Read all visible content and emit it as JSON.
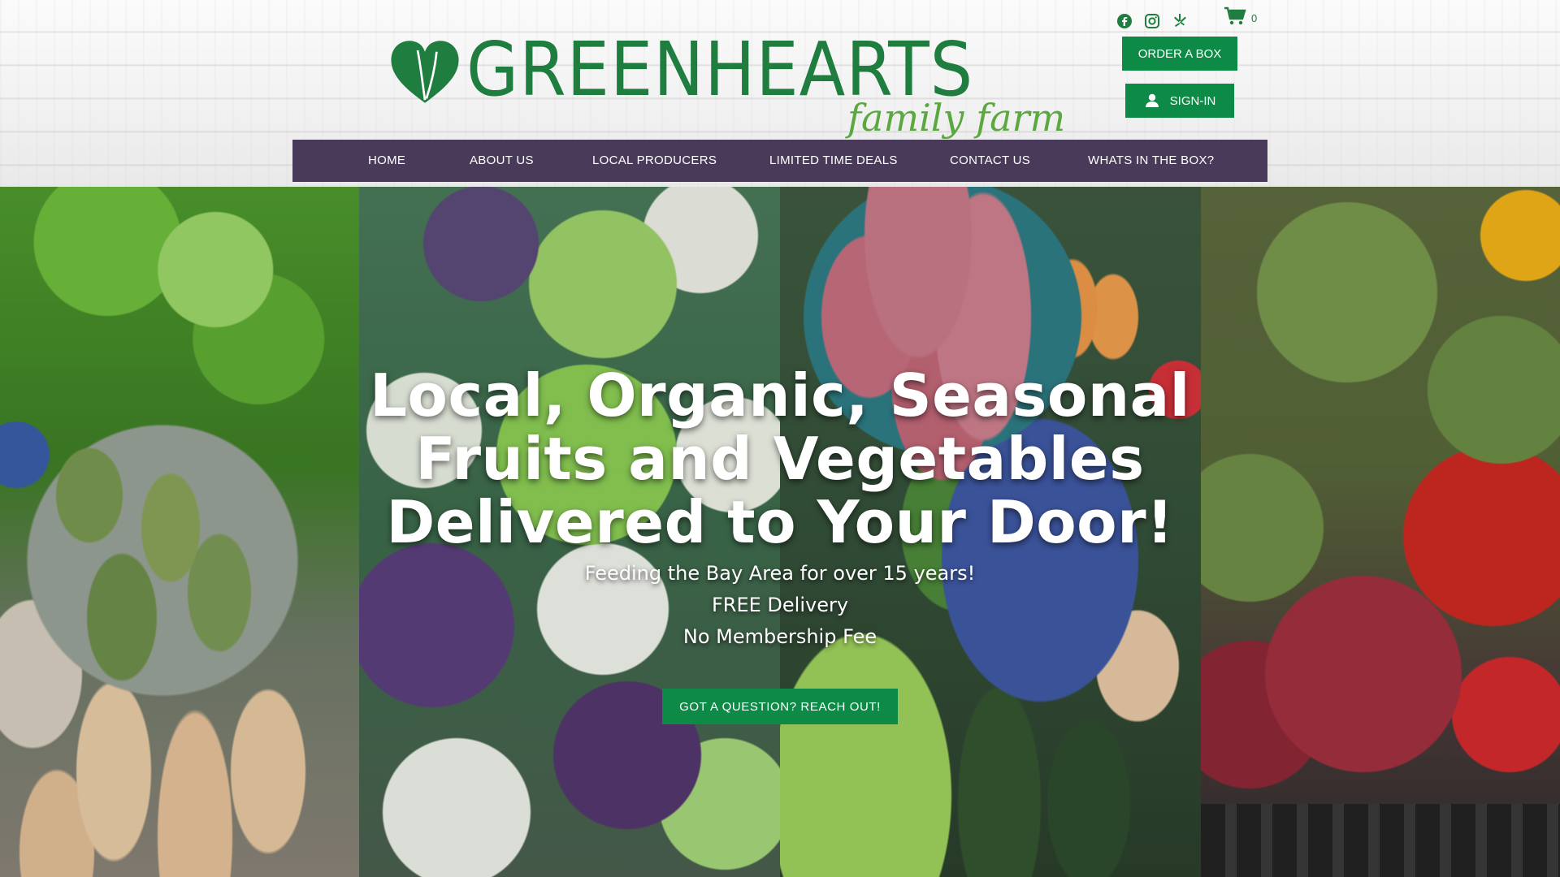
{
  "brand": {
    "name": "GREENHEARTS",
    "tagline": "family farm",
    "colors": {
      "green": "#0e8a47",
      "nav_bg": "#4a3a5a",
      "logo_green": "#1f7d3f"
    }
  },
  "header": {
    "social": [
      {
        "name": "facebook-icon"
      },
      {
        "name": "instagram-icon"
      },
      {
        "name": "yelp-icon"
      }
    ],
    "cart_count": "0",
    "order_button": "ORDER A BOX",
    "signin_button": "SIGN-IN"
  },
  "nav": {
    "items": [
      {
        "label": "HOME"
      },
      {
        "label": "ABOUT US"
      },
      {
        "label": "LOCAL PRODUCERS"
      },
      {
        "label": "LIMITED TIME DEALS"
      },
      {
        "label": "CONTACT US"
      },
      {
        "label": "WHATS IN THE BOX?"
      }
    ]
  },
  "hero": {
    "headline_lines": [
      "Local, Organic, Seasonal",
      "Fruits and Vegetables",
      "Delivered to Your Door!"
    ],
    "subtext": [
      "Feeding the Bay Area for over 15 years!",
      "FREE Delivery",
      "No Membership Fee"
    ],
    "cta_button": "GOT A QUESTION? REACH OUT!"
  }
}
